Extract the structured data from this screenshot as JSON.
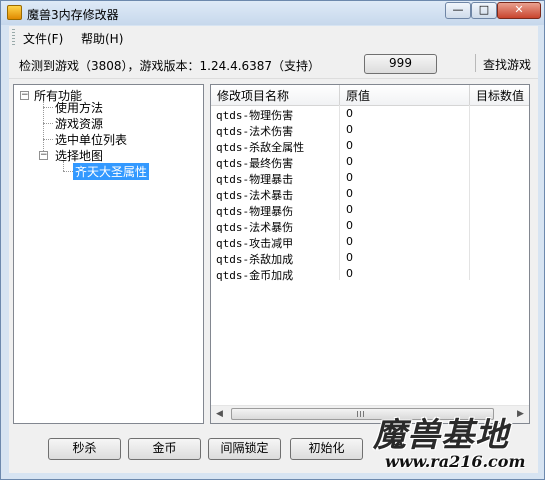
{
  "window": {
    "title": "魔兽3内存修改器",
    "min_glyph": "—",
    "max_glyph": "□",
    "close_glyph": "✕"
  },
  "menu": {
    "file": "文件(F)",
    "help": "帮助(H)"
  },
  "toolbar": {
    "status": "检测到游戏（3808），游戏版本：1.24.4.6387（支持）",
    "button_999": "999",
    "find_game": "查找游戏"
  },
  "tree": {
    "root": "所有功能",
    "children": [
      "使用方法",
      "游戏资源",
      "选中单位列表",
      "选择地图"
    ],
    "grandchild": "齐天大圣属性",
    "expander_glyph": "−"
  },
  "grid": {
    "columns": [
      "修改项目名称",
      "原值",
      "目标数值"
    ],
    "rows": [
      {
        "name": "qtds-物理伤害",
        "value": "0"
      },
      {
        "name": "qtds-法术伤害",
        "value": "0"
      },
      {
        "name": "qtds-杀敌全属性",
        "value": "0"
      },
      {
        "name": "qtds-最终伤害",
        "value": "0"
      },
      {
        "name": "qtds-物理暴击",
        "value": "0"
      },
      {
        "name": "qtds-法术暴击",
        "value": "0"
      },
      {
        "name": "qtds-物理暴伤",
        "value": "0"
      },
      {
        "name": "qtds-法术暴伤",
        "value": "0"
      },
      {
        "name": "qtds-攻击减甲",
        "value": "0"
      },
      {
        "name": "qtds-杀敌加成",
        "value": "0"
      },
      {
        "name": "qtds-金币加成",
        "value": "0"
      }
    ],
    "scroll_left": "◀",
    "scroll_right": "▶"
  },
  "buttons": {
    "kill": "秒杀",
    "gold": "金币",
    "interval_lock": "间隔锁定",
    "init": "初始化"
  },
  "watermark": {
    "logo": "魔兽基地",
    "url": "www.ra216.com"
  }
}
